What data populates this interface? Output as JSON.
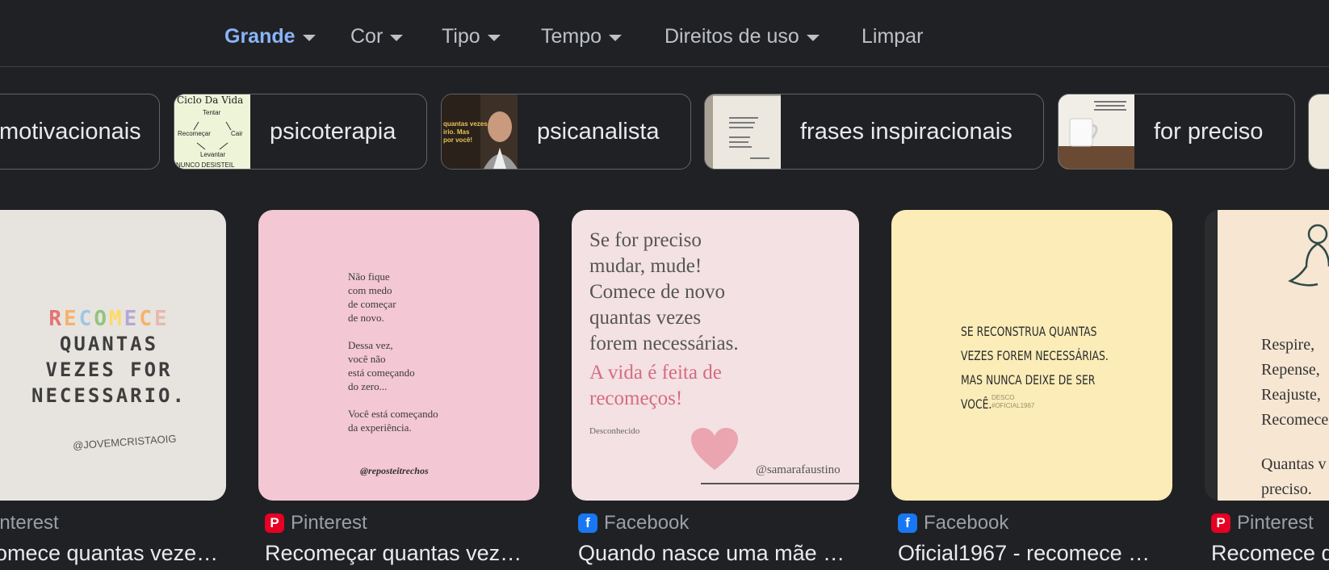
{
  "filters": [
    {
      "label": "Grande",
      "active": true,
      "has_menu": true
    },
    {
      "label": "Cor",
      "has_menu": true
    },
    {
      "label": "Tipo",
      "has_menu": true
    },
    {
      "label": "Tempo",
      "has_menu": true
    },
    {
      "label": "Direitos de uso",
      "has_menu": true
    },
    {
      "label": "Limpar",
      "has_menu": false
    }
  ],
  "chips": [
    {
      "label": "motivacionais"
    },
    {
      "label": "psicoterapia",
      "thumb": {
        "title": "Ciclo Da Vida",
        "items": [
          "Tentar",
          "Recomeçar",
          "Cair",
          "Levantar"
        ],
        "footer": "NUNCO DESISTEIL"
      }
    },
    {
      "label": "psicanalista",
      "thumb": {
        "line1": "quantas vezes",
        "line2": "irio. Mas",
        "line3": "por você!"
      }
    },
    {
      "label": "frases inspiracionais"
    },
    {
      "label": "for preciso"
    }
  ],
  "results": [
    {
      "source": "interest",
      "source_icon": "pinterest-icon",
      "title": "omece quantas veze…",
      "image": {
        "word": "RECOMECE",
        "lines": [
          "QUANTAS",
          "VEZES FOR",
          "NECESSARIO."
        ],
        "handle": "@JOVEMCRISTAOIG"
      }
    },
    {
      "source": "Pinterest",
      "source_icon": "pinterest-icon",
      "title": "Recomeçar quantas vez…",
      "image": {
        "paragraphs": [
          "Não fique\ncom medo\nde começar\nde novo.",
          "Dessa vez,\nvocê não\nestá começando\ndo zero...",
          "Você está começando\nda experiência."
        ],
        "handle": "@reposteitrechos"
      }
    },
    {
      "source": "Facebook",
      "source_icon": "facebook-icon",
      "title": "Quando nasce uma mãe …",
      "image": {
        "lines": [
          "Se for preciso",
          "mudar, mude!",
          "Comece de novo",
          "quantas vezes",
          "forem necessárias."
        ],
        "highlight": [
          "A vida é feita de",
          "recomeços!"
        ],
        "author": "Desconhecido",
        "handle": "@samarafaustino"
      }
    },
    {
      "source": "Facebook",
      "source_icon": "facebook-icon",
      "title": "Oficial1967 - recomece …",
      "image": {
        "lines": [
          "SE RECONSTRUA QUANTAS",
          "VEZES FOREM NECESSÁRIAS.",
          "MAS NUNCA DEIXE DE SER",
          "VOCÊ."
        ],
        "signature": "DESCO\n#OFICIAL1967"
      }
    },
    {
      "source": "Pinterest",
      "source_icon": "pinterest-icon",
      "title": "Recomece d",
      "image": {
        "lines": [
          "Respire,",
          "Repense,",
          "Reajuste,",
          "Recomece"
        ],
        "tail": [
          "Quantas v",
          "preciso."
        ]
      }
    }
  ],
  "colors": {
    "background": "#202124",
    "active_filter": "#8ab4f8",
    "text": "#e8eaed",
    "muted": "#9aa0a6"
  }
}
